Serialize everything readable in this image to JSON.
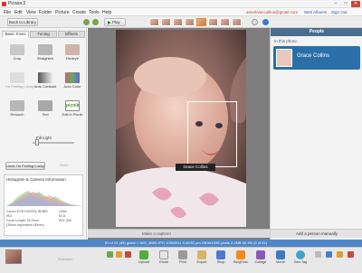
{
  "window": {
    "title": "Picasa 3",
    "minimize": "–",
    "maximize": "□",
    "close": "✕"
  },
  "menu": {
    "items": [
      "File",
      "Edit",
      "View",
      "Folder",
      "Picture",
      "Create",
      "Tools",
      "Help"
    ],
    "account_email": "amerkvaccollins@gmail.com",
    "web_albums_link": "Web Albums",
    "sign_out_link": "Sign Out"
  },
  "toolbar": {
    "back_label": "Back to Library",
    "play_label": "Play"
  },
  "edit_panel": {
    "tabs": [
      "Basic Fixes",
      "Tuning",
      "Effects"
    ],
    "tools": [
      {
        "label": "Crop",
        "icon": "crop-icon"
      },
      {
        "label": "Straighten",
        "icon": "straighten-icon"
      },
      {
        "label": "Redeye",
        "icon": "redeye-icon"
      },
      {
        "label": "I'm Feeling Lucky",
        "icon": "lucky-icon"
      },
      {
        "label": "Auto Contrast",
        "icon": "auto-contrast-icon"
      },
      {
        "label": "Auto Color",
        "icon": "auto-color-icon"
      },
      {
        "label": "Retouch",
        "icon": "retouch-icon"
      },
      {
        "label": "Text",
        "icon": "text-icon"
      },
      {
        "label": "Edit in Picnik",
        "icon": "picnik-icon",
        "badge": "picnik"
      }
    ],
    "fill_light_label": "Fill Light",
    "fill_light_value": 0.05,
    "undo_label": "Undo I'm Feeling Lucky",
    "redo_label": "Redo"
  },
  "histogram": {
    "title": "Histogram & Camera Information",
    "camera_lines": [
      {
        "left": "Canon EOS DIGITAL REBEL",
        "right": "1/30s"
      },
      {
        "left": "ISO",
        "right": "f/2.8"
      },
      {
        "left": "Focal Length: 50.0mm",
        "right": "ISO: 800"
      },
      {
        "left": "(35mm equivalent: 80mm)",
        "right": ""
      }
    ]
  },
  "viewer": {
    "face_name": "Grace Collins",
    "caption_placeholder": "Make a caption!"
  },
  "people_panel": {
    "header": "People",
    "subheader": "In this photo:",
    "person_name": "Grace Collins",
    "add_person_label": "Add a person manually"
  },
  "status": {
    "text": "81 of 21 (45) grace > IMG_3683.JPG   1/30/2011 9:49:52 pm   2304x1536 pixels   2.2MB   69.3% (0 of 61)"
  },
  "bottom_bar": {
    "selection_label": "Selection",
    "actions": [
      {
        "label": "Upload",
        "icon": "upload-icon",
        "color": "#4fae3c"
      },
      {
        "label": "Email",
        "icon": "email-icon",
        "color": "#e5e5e5"
      },
      {
        "label": "Print",
        "icon": "print-icon",
        "color": "#9a9a9a"
      },
      {
        "label": "Export",
        "icon": "export-icon",
        "color": "#d7b46a"
      },
      {
        "label": "Shop",
        "icon": "shop-icon",
        "color": "#4a7bd0"
      },
      {
        "label": "BlogThis!",
        "icon": "blog-icon",
        "color": "#f28a1f"
      },
      {
        "label": "Collage",
        "icon": "collage-icon",
        "color": "#8a5ab4"
      },
      {
        "label": "Movie",
        "icon": "movie-icon",
        "color": "#3a7ac9"
      },
      {
        "label": "Geo-Tag",
        "icon": "geotag-icon",
        "color": "#3fa2c9"
      }
    ]
  }
}
